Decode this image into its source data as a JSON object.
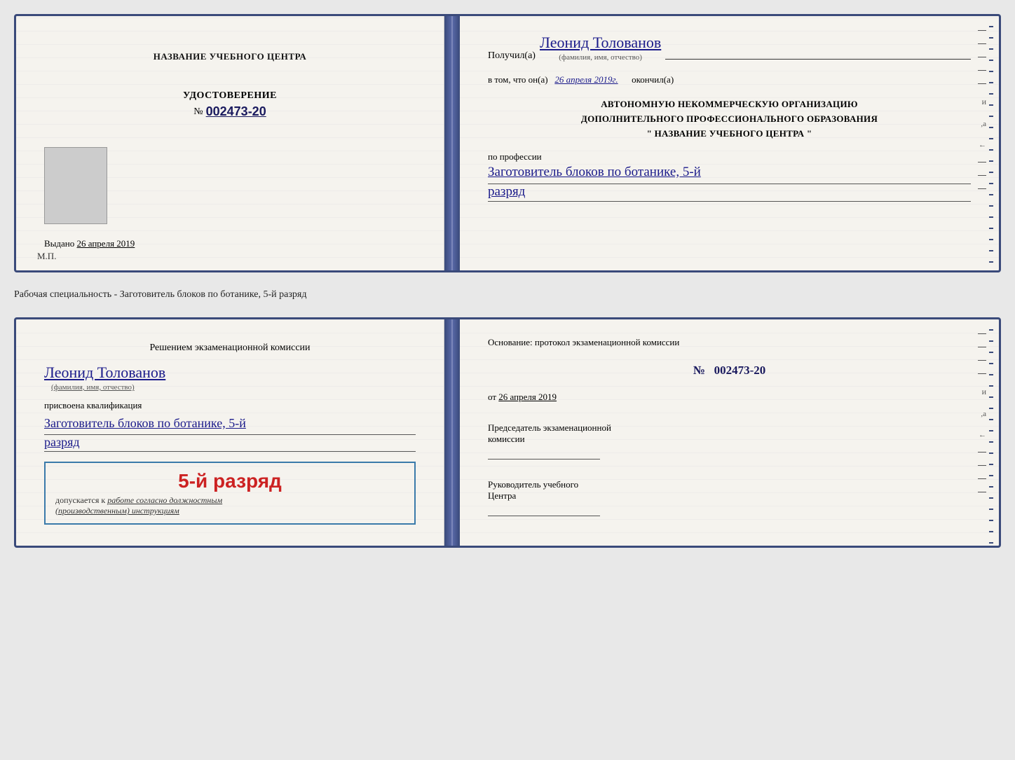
{
  "doc1": {
    "left": {
      "center_title": "НАЗВАНИЕ УЧЕБНОГО ЦЕНТРА",
      "udostoverenie_label": "УДОСТОВЕРЕНИЕ",
      "number_prefix": "№",
      "number": "002473-20",
      "vydano_prefix": "Выдано",
      "vydano_date": "26 апреля 2019",
      "mp_label": "М.П."
    },
    "right": {
      "poluchil_prefix": "Получил(а)",
      "recipient_name": "Леонид Толованов",
      "dash": "–",
      "fio_label": "(фамилия, имя, отчество)",
      "vtom_prefix": "в том, что он(а)",
      "date_italic": "26 апреля 2019г.",
      "okkonchil": "окончил(а)",
      "org_line1": "АВТОНОМНУЮ НЕКОММЕРЧЕСКУЮ ОРГАНИЗАЦИЮ",
      "org_line2": "ДОПОЛНИТЕЛЬНОГО ПРОФЕССИОНАЛЬНОГО ОБРАЗОВАНИЯ",
      "org_line3": "\" НАЗВАНИЕ УЧЕБНОГО ЦЕНТРА \"",
      "po_professii": "по профессии",
      "profession": "Заготовитель блоков по ботанике, 5-й",
      "razryad": "разряд"
    }
  },
  "separator": "Рабочая специальность - Заготовитель блоков по ботанике, 5-й разряд",
  "doc2": {
    "left": {
      "komissia_prefix": "Решением экзаменационной комиссии",
      "komissia_name": "Леонид Толованов",
      "fio_label": "(фамилия, имя, отчество)",
      "prisvoena": "присвоена квалификация",
      "kvalif": "Заготовитель блоков по ботанике, 5-й",
      "razryad": "разряд",
      "badge_number": "5-й разряд",
      "dopuskaetsya": "допускается к",
      "rabote": "работе согласно должностным",
      "instruktsiyam": "(производственным) инструкциям"
    },
    "right": {
      "osnovanie": "Основание: протокол экзаменационной комиссии",
      "proto_prefix": "№",
      "proto_number": "002473-20",
      "ot_prefix": "от",
      "ot_date": "26 апреля 2019",
      "predsedatel_line1": "Председатель экзаменационной",
      "predsedatel_line2": "комиссии",
      "rukovoditel_line1": "Руководитель учебного",
      "rukovoditel_line2": "Центра"
    }
  }
}
